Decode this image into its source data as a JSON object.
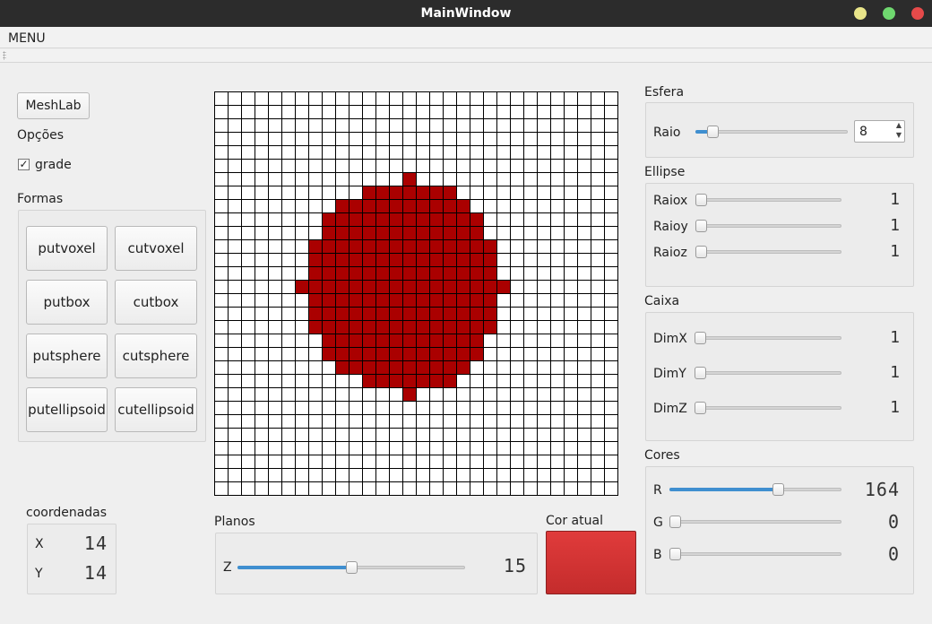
{
  "window": {
    "title": "MainWindow"
  },
  "menu": {
    "label": "MENU"
  },
  "left": {
    "meshlab_button": "MeshLab",
    "options_label": "Opções",
    "grid_checkbox_label": "grade",
    "shapes_label": "Formas",
    "shape_buttons": [
      "putvoxel",
      "cutvoxel",
      "putbox",
      "cutbox",
      "putsphere",
      "cutsphere",
      "putellipsoid",
      "cutellipsoid"
    ],
    "coords_label": "coordenadas",
    "x_label": "X",
    "x_value": "14",
    "y_label": "Y",
    "y_value": "14"
  },
  "grid": {
    "cols": 30,
    "rows": 30,
    "fill_color": "#aa0000",
    "filled_rows": {
      "6": [
        14,
        14
      ],
      "7": [
        11,
        17
      ],
      "8": [
        9,
        18
      ],
      "9": [
        8,
        19
      ],
      "10": [
        8,
        19
      ],
      "11": [
        7,
        20
      ],
      "12": [
        7,
        20
      ],
      "13": [
        7,
        20
      ],
      "14": [
        6,
        21
      ],
      "15": [
        7,
        20
      ],
      "16": [
        7,
        20
      ],
      "17": [
        7,
        20
      ],
      "18": [
        8,
        19
      ],
      "19": [
        8,
        19
      ],
      "20": [
        9,
        18
      ],
      "21": [
        11,
        17
      ],
      "22": [
        14,
        14
      ]
    }
  },
  "planes": {
    "label": "Planos",
    "z_label": "Z",
    "z_value": "15",
    "z_fraction": 0.5
  },
  "current_color": {
    "label": "Cor atual",
    "color": "#e03b3b"
  },
  "sphere": {
    "label": "Esfera",
    "radius_label": "Raio",
    "radius_value": "8",
    "radius_fraction": 0.08
  },
  "ellipse": {
    "label": "Ellipse",
    "rx_label": "Raiox",
    "ry_label": "Raioy",
    "rz_label": "Raioz",
    "rx_value": "1",
    "ry_value": "1",
    "rz_value": "1"
  },
  "box": {
    "label": "Caixa",
    "dx_label": "DimX",
    "dy_label": "DimY",
    "dz_label": "DimZ",
    "dx_value": "1",
    "dy_value": "1",
    "dz_value": "1"
  },
  "colors": {
    "label": "Cores",
    "r_label": "R",
    "r_value": "164",
    "r_fraction": 0.64,
    "g_label": "G",
    "g_value": "0",
    "b_label": "B",
    "b_value": "0"
  }
}
